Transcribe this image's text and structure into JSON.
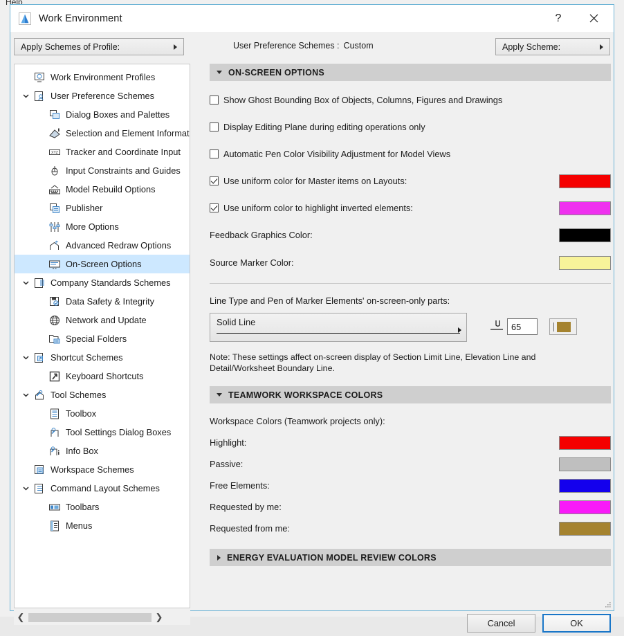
{
  "backdrop": {
    "menu_help": "Help"
  },
  "window": {
    "title": "Work Environment",
    "help_button": "?",
    "close_button": "✕",
    "app_icon": "archicad-logo-icon"
  },
  "topbar": {
    "apply_profile_label": "Apply Schemes of Profile:",
    "scheme_status_label": "User Preference Schemes :",
    "scheme_status_value": "Custom",
    "apply_scheme_label": "Apply Scheme:"
  },
  "sidebar": {
    "items": [
      {
        "label": "Work Environment Profiles",
        "indent": 0,
        "chevron": "none",
        "icon": "work-environment-profiles-icon",
        "selected": false
      },
      {
        "label": "User Preference Schemes",
        "indent": 0,
        "chevron": "expanded",
        "icon": "user-preference-schemes-icon",
        "selected": false
      },
      {
        "label": "Dialog Boxes and Palettes",
        "indent": 1,
        "chevron": "none",
        "icon": "dialog-boxes-icon",
        "selected": false
      },
      {
        "label": "Selection and Element Information",
        "indent": 1,
        "chevron": "none",
        "icon": "selection-element-info-icon",
        "selected": false
      },
      {
        "label": "Tracker and Coordinate Input",
        "indent": 1,
        "chevron": "none",
        "icon": "tracker-coordinate-icon",
        "selected": false
      },
      {
        "label": "Input Constraints and Guides",
        "indent": 1,
        "chevron": "none",
        "icon": "input-constraints-icon",
        "selected": false
      },
      {
        "label": "Model Rebuild Options",
        "indent": 1,
        "chevron": "none",
        "icon": "model-rebuild-icon",
        "selected": false
      },
      {
        "label": "Publisher",
        "indent": 1,
        "chevron": "none",
        "icon": "publisher-icon",
        "selected": false
      },
      {
        "label": "More Options",
        "indent": 1,
        "chevron": "none",
        "icon": "more-options-icon",
        "selected": false
      },
      {
        "label": "Advanced Redraw Options",
        "indent": 1,
        "chevron": "none",
        "icon": "advanced-redraw-icon",
        "selected": false
      },
      {
        "label": "On-Screen Options",
        "indent": 1,
        "chevron": "none",
        "icon": "on-screen-options-icon",
        "selected": true
      },
      {
        "label": "Company Standards Schemes",
        "indent": 0,
        "chevron": "expanded",
        "icon": "company-standards-icon",
        "selected": false
      },
      {
        "label": "Data Safety & Integrity",
        "indent": 1,
        "chevron": "none",
        "icon": "data-safety-icon",
        "selected": false
      },
      {
        "label": "Network and Update",
        "indent": 1,
        "chevron": "none",
        "icon": "network-update-icon",
        "selected": false
      },
      {
        "label": "Special Folders",
        "indent": 1,
        "chevron": "none",
        "icon": "special-folders-icon",
        "selected": false
      },
      {
        "label": "Shortcut Schemes",
        "indent": 0,
        "chevron": "expanded",
        "icon": "shortcut-schemes-icon",
        "selected": false
      },
      {
        "label": "Keyboard Shortcuts",
        "indent": 1,
        "chevron": "none",
        "icon": "keyboard-shortcuts-icon",
        "selected": false
      },
      {
        "label": "Tool Schemes",
        "indent": 0,
        "chevron": "expanded",
        "icon": "tool-schemes-icon",
        "selected": false
      },
      {
        "label": "Toolbox",
        "indent": 1,
        "chevron": "none",
        "icon": "toolbox-icon",
        "selected": false
      },
      {
        "label": "Tool Settings Dialog Boxes",
        "indent": 1,
        "chevron": "none",
        "icon": "tool-settings-icon",
        "selected": false
      },
      {
        "label": "Info Box",
        "indent": 1,
        "chevron": "none",
        "icon": "info-box-icon",
        "selected": false
      },
      {
        "label": "Workspace Schemes",
        "indent": 0,
        "chevron": "none",
        "icon": "workspace-schemes-icon",
        "selected": false
      },
      {
        "label": "Command Layout Schemes",
        "indent": 0,
        "chevron": "expanded",
        "icon": "command-layout-icon",
        "selected": false
      },
      {
        "label": "Toolbars",
        "indent": 1,
        "chevron": "none",
        "icon": "toolbars-icon",
        "selected": false
      },
      {
        "label": "Menus",
        "indent": 1,
        "chevron": "none",
        "icon": "menus-icon",
        "selected": false
      }
    ]
  },
  "onscreen": {
    "header": "ON-SCREEN OPTIONS",
    "checkboxes": [
      {
        "label": "Show Ghost Bounding Box of Objects, Columns, Figures and Drawings",
        "checked": false,
        "swatch": null
      },
      {
        "label": "Display Editing Plane during editing operations only",
        "checked": false,
        "swatch": null
      },
      {
        "label": "Automatic Pen Color Visibility Adjustment for Model Views",
        "checked": false,
        "swatch": null
      },
      {
        "label": "Use uniform color for Master items on Layouts:",
        "checked": true,
        "swatch": "#f50000"
      },
      {
        "label": "Use uniform color to highlight inverted elements:",
        "checked": true,
        "swatch": "#ef31ef"
      }
    ],
    "color_rows": [
      {
        "label": "Feedback Graphics Color:",
        "swatch": "#000000"
      },
      {
        "label": "Source Marker Color:",
        "swatch": "#f8f39a"
      }
    ],
    "linetype_title": "Line Type and Pen of Marker Elements' on-screen-only parts:",
    "linetype_value": "Solid Line",
    "pen_number": "65",
    "pen_color": "#a5832f",
    "note": "Note: These settings affect on-screen display of Section Limit Line, Elevation Line and Detail/Worksheet Boundary Line."
  },
  "teamwork": {
    "header": "TEAMWORK WORKSPACE COLORS",
    "subtitle": "Workspace Colors (Teamwork projects only):",
    "rows": [
      {
        "label": "Highlight:",
        "swatch": "#f50000"
      },
      {
        "label": "Passive:",
        "swatch": "#bfbfbf"
      },
      {
        "label": "Free Elements:",
        "swatch": "#1400ed"
      },
      {
        "label": "Requested by me:",
        "swatch": "#f919f9"
      },
      {
        "label": "Requested from me:",
        "swatch": "#a5832f"
      }
    ]
  },
  "energy": {
    "header": "ENERGY EVALUATION MODEL REVIEW COLORS"
  },
  "footer": {
    "cancel_label": "Cancel",
    "ok_label": "OK"
  },
  "colors": {
    "selection_blue": "#cde8ff",
    "section_gray": "#cfcfcf",
    "dialog_bg": "#f0f0f0",
    "focus_blue": "#1976c8",
    "window_border": "#6fb5d6"
  }
}
